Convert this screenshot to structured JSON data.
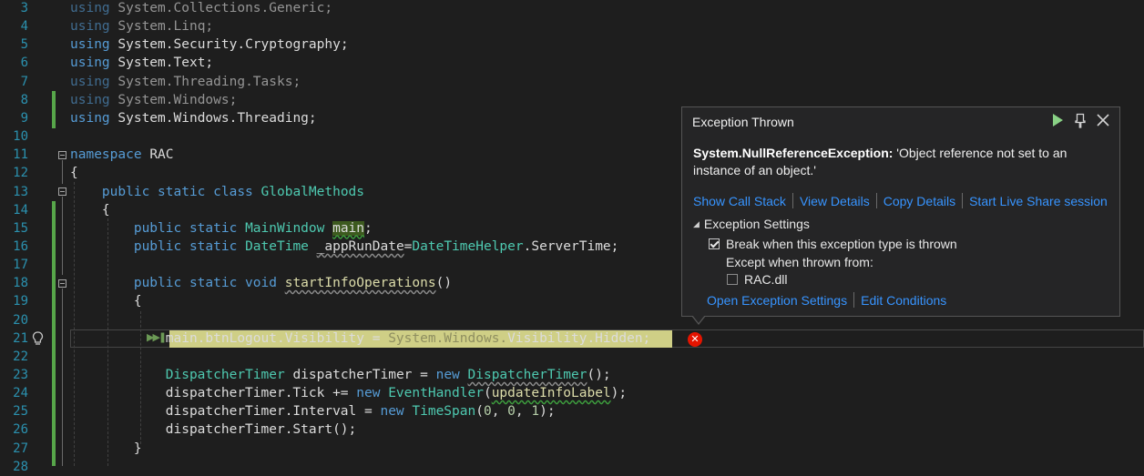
{
  "editor": {
    "lines": [
      {
        "num": "3",
        "segs": [
          [
            "kw dim",
            "using "
          ],
          [
            "pr dim",
            "System.Collections.Generic;"
          ]
        ]
      },
      {
        "num": "4",
        "segs": [
          [
            "kw dim",
            "using "
          ],
          [
            "pr dim",
            "System.Linq;"
          ]
        ]
      },
      {
        "num": "5",
        "segs": [
          [
            "kw",
            "using "
          ],
          [
            "pr",
            "System.Security.Cryptography;"
          ]
        ]
      },
      {
        "num": "6",
        "segs": [
          [
            "kw",
            "using "
          ],
          [
            "pr",
            "System.Text;"
          ]
        ]
      },
      {
        "num": "7",
        "segs": [
          [
            "kw dim",
            "using "
          ],
          [
            "pr dim",
            "System.Threading.Tasks;"
          ]
        ]
      },
      {
        "num": "8",
        "segs": [
          [
            "kw dim",
            "using "
          ],
          [
            "pr dim",
            "System.Windows;"
          ]
        ]
      },
      {
        "num": "9",
        "segs": [
          [
            "kw",
            "using "
          ],
          [
            "pr",
            "System.Windows.Threading;"
          ]
        ]
      },
      {
        "num": "10",
        "segs": []
      },
      {
        "num": "11",
        "segs": [
          [
            "kw",
            "namespace "
          ],
          [
            "pr",
            "RAC"
          ]
        ]
      },
      {
        "num": "12",
        "segs": [
          [
            "pr",
            "{"
          ]
        ]
      },
      {
        "num": "13",
        "segs": [
          [
            "pr",
            "    "
          ],
          [
            "kw",
            "public static class "
          ],
          [
            "ty",
            "GlobalMethods"
          ]
        ]
      },
      {
        "num": "14",
        "segs": [
          [
            "pr",
            "    {"
          ]
        ]
      },
      {
        "num": "15",
        "segs": [
          [
            "pr",
            "        "
          ],
          [
            "kw",
            "public static "
          ],
          [
            "ty",
            "MainWindow "
          ],
          [
            "pr hl-main sq",
            "main"
          ],
          [
            "pr",
            ";"
          ]
        ]
      },
      {
        "num": "16",
        "segs": [
          [
            "pr",
            "        "
          ],
          [
            "kw",
            "public static "
          ],
          [
            "ty",
            "DateTime "
          ],
          [
            "pr sq-grey",
            "_appRunDate"
          ],
          [
            "pr",
            "="
          ],
          [
            "ty",
            "DateTimeHelper"
          ],
          [
            "pr",
            ".ServerTime;"
          ]
        ]
      },
      {
        "num": "17",
        "segs": []
      },
      {
        "num": "18",
        "segs": [
          [
            "pr",
            "        "
          ],
          [
            "kw",
            "public static void "
          ],
          [
            "mt sq-grey",
            "startInfoOperations"
          ],
          [
            "pr",
            "()"
          ]
        ]
      },
      {
        "num": "19",
        "segs": [
          [
            "pr",
            "        {"
          ]
        ]
      },
      {
        "num": "20",
        "segs": []
      },
      {
        "num": "21",
        "segs": [
          [
            "pr",
            "            main.btnLogout.Visibility = "
          ],
          [
            "c-dim",
            "System.Windows."
          ],
          [
            "pr",
            "Visibility.Hidden;"
          ]
        ]
      },
      {
        "num": "22",
        "segs": []
      },
      {
        "num": "23",
        "segs": [
          [
            "pr",
            "            "
          ],
          [
            "ty",
            "DispatcherTimer "
          ],
          [
            "pr",
            "dispatcherTimer = "
          ],
          [
            "kw",
            "new "
          ],
          [
            "ty sq-grey",
            "DispatcherTimer"
          ],
          [
            "pr",
            "();"
          ]
        ]
      },
      {
        "num": "24",
        "segs": [
          [
            "pr",
            "            dispatcherTimer.Tick += "
          ],
          [
            "kw",
            "new "
          ],
          [
            "ty",
            "EventHandler"
          ],
          [
            "pr",
            "("
          ],
          [
            "mt sq",
            "updateInfoLabel"
          ],
          [
            "pr",
            ");"
          ]
        ]
      },
      {
        "num": "25",
        "segs": [
          [
            "pr",
            "            dispatcherTimer.Interval = "
          ],
          [
            "kw",
            "new "
          ],
          [
            "ty",
            "TimeSpan"
          ],
          [
            "pr",
            "("
          ],
          [
            "nu",
            "0"
          ],
          [
            "pr",
            ", "
          ],
          [
            "nu",
            "0"
          ],
          [
            "pr",
            ", "
          ],
          [
            "nu",
            "1"
          ],
          [
            "pr",
            ");"
          ]
        ]
      },
      {
        "num": "26",
        "segs": [
          [
            "pr",
            "            dispatcherTimer.Start();"
          ]
        ]
      },
      {
        "num": "27",
        "segs": [
          [
            "pr",
            "        }"
          ]
        ]
      },
      {
        "num": "28",
        "segs": []
      }
    ],
    "current_line": "21"
  },
  "popup": {
    "title": "Exception Thrown",
    "exception_type": "System.NullReferenceException:",
    "message": "'Object reference not set to an instance of an object.'",
    "links": [
      "Show Call Stack",
      "View Details",
      "Copy Details",
      "Start Live Share session"
    ],
    "settings_header": "Exception Settings",
    "break_label": "Break when this exception type is thrown",
    "break_checked": true,
    "except_label": "Except when thrown from:",
    "module_label": "RAC.dll",
    "module_checked": false,
    "bottom_links": [
      "Open Exception Settings",
      "Edit Conditions"
    ]
  },
  "icons": {
    "continue": "continue-play-icon",
    "pin": "pin-icon",
    "close": "close-icon",
    "lightbulb": "lightbulb-icon",
    "error": "error-icon",
    "exec_arrow": "execution-pointer-icon"
  },
  "colors": {
    "background": "#1e1e1e",
    "keyword": "#569cd6",
    "type": "#4ec9b0",
    "method": "#dcdcaa",
    "line_number": "#2b91af",
    "link": "#3794ff",
    "exec_highlight": "#cfcf86",
    "error": "#e51400",
    "change_bar": "#57a64a"
  }
}
